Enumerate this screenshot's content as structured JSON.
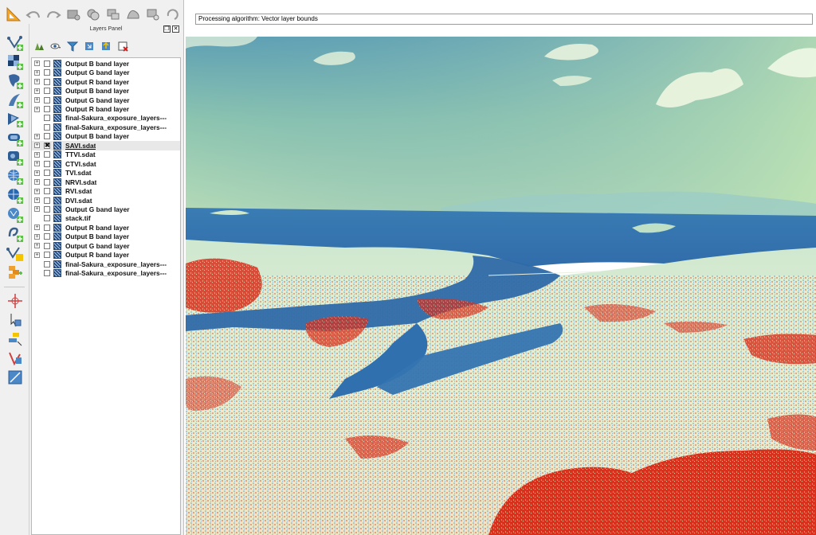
{
  "layers_panel": {
    "title": "Layers Panel",
    "layers": [
      {
        "label": "Output B band layer",
        "expandable": true,
        "checked": false
      },
      {
        "label": "Output G band layer",
        "expandable": true,
        "checked": false
      },
      {
        "label": "Output R band layer",
        "expandable": true,
        "checked": false
      },
      {
        "label": "Output B band layer",
        "expandable": true,
        "checked": false
      },
      {
        "label": "Output G band layer",
        "expandable": true,
        "checked": false
      },
      {
        "label": "Output R band layer",
        "expandable": true,
        "checked": false
      },
      {
        "label": "final-Sakura_exposure_layers---",
        "expandable": false,
        "checked": false
      },
      {
        "label": "final-Sakura_exposure_layers---",
        "expandable": false,
        "checked": false
      },
      {
        "label": "Output B band layer",
        "expandable": true,
        "checked": false
      },
      {
        "label": "SAVI.sdat",
        "expandable": true,
        "checked": true,
        "active": true
      },
      {
        "label": "TTVI.sdat",
        "expandable": true,
        "checked": false
      },
      {
        "label": "CTVI.sdat",
        "expandable": true,
        "checked": false
      },
      {
        "label": "TVI.sdat",
        "expandable": true,
        "checked": false
      },
      {
        "label": "NRVI.sdat",
        "expandable": true,
        "checked": false
      },
      {
        "label": "RVI.sdat",
        "expandable": true,
        "checked": false
      },
      {
        "label": "DVI.sdat",
        "expandable": true,
        "checked": false
      },
      {
        "label": "Output G band layer",
        "expandable": true,
        "checked": false
      },
      {
        "label": "stack.tif",
        "expandable": false,
        "checked": false
      },
      {
        "label": "Output R band layer",
        "expandable": true,
        "checked": false
      },
      {
        "label": "Output B band layer",
        "expandable": true,
        "checked": false
      },
      {
        "label": "Output G band layer",
        "expandable": true,
        "checked": false
      },
      {
        "label": "Output R band layer",
        "expandable": true,
        "checked": false
      },
      {
        "label": "final-Sakura_exposure_layers---",
        "expandable": false,
        "checked": false
      },
      {
        "label": "final-Sakura_exposure_layers---",
        "expandable": false,
        "checked": false
      }
    ],
    "expand_glyph": "+",
    "check_glyph": "✖",
    "float_glyph": "❐",
    "close_glyph": "✕"
  },
  "status": {
    "text": "Processing algorithm: Vector layer bounds"
  },
  "colors": {
    "ramp_low": "#2f6fb0",
    "ramp_mid": "#e8f0c8",
    "ramp_high": "#d8321e"
  }
}
